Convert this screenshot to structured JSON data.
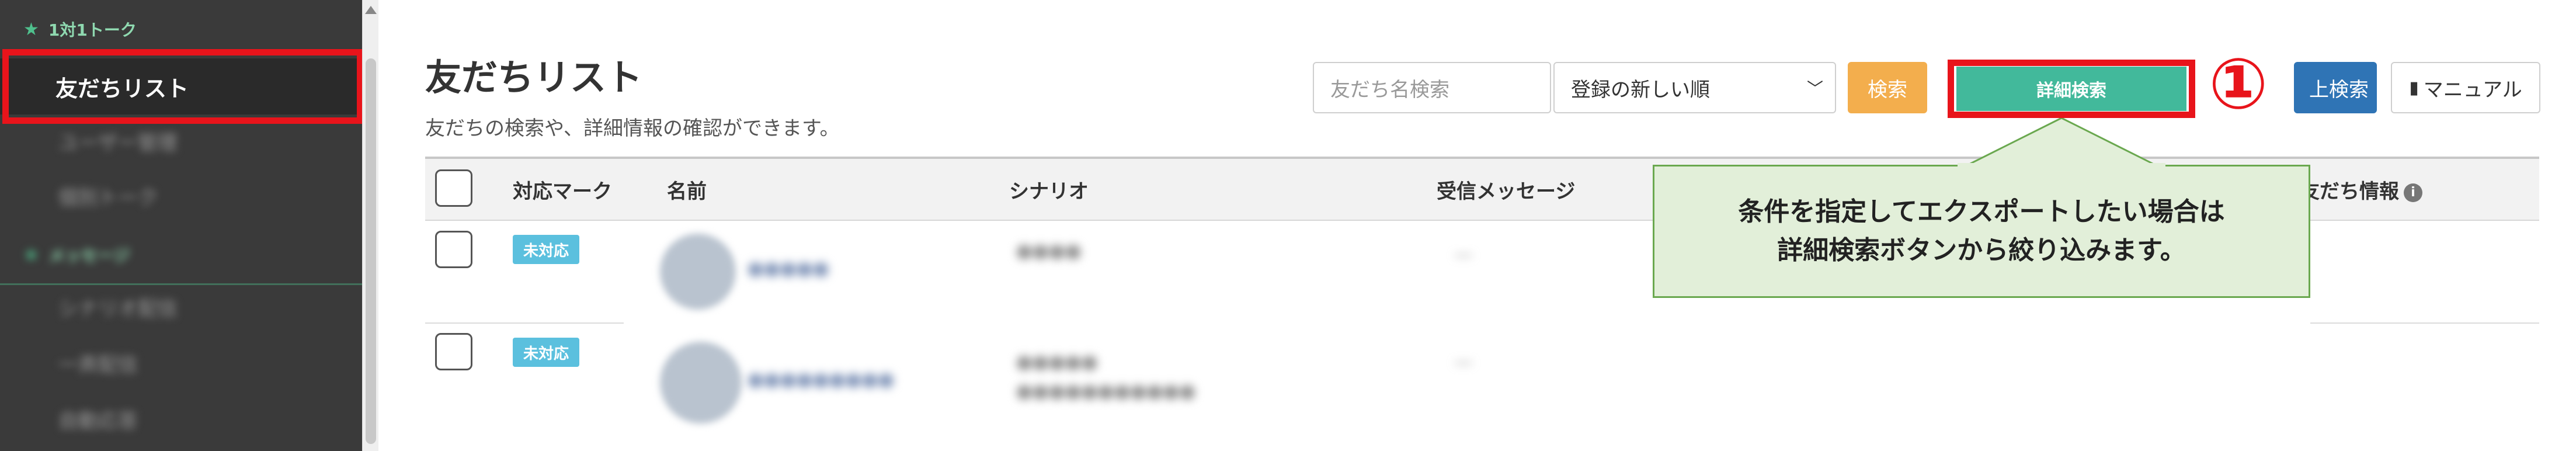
{
  "sidebar": {
    "section_talk": "1対1トーク",
    "active_item": "友だちリスト",
    "item_2": "ユーザー管理",
    "item_3": "個別トーク",
    "section_message": "メッセージ",
    "item_5": "シナリオ配信",
    "item_6": "一斉配信",
    "item_7": "自動応答"
  },
  "header": {
    "title": "友だちリスト",
    "description": "友だちの検索や、詳細情報の確認ができます。",
    "search_placeholder": "友だち名検索",
    "sort_value": "登録の新しい順",
    "search_button": "検索",
    "detail_search_button": "詳細検索",
    "csv_button_partial": "上検索",
    "manual_button": "マニュアル"
  },
  "annotation": {
    "step_number": "①",
    "callout_line1": "条件を指定してエクスポートしたい場合は",
    "callout_line2": "詳細検索ボタンから絞り込みます。"
  },
  "table": {
    "columns": {
      "mark": "対応マーク",
      "name": "名前",
      "scenario": "シナリオ",
      "received": "受信メッセージ",
      "friend_info": "友だち情報"
    },
    "rows": [
      {
        "status": "未対応",
        "name": "●●●●●",
        "scenario": "●●●●",
        "message": "—"
      },
      {
        "status": "未対応",
        "name": "●●●●●●●●●",
        "scenario": "●●●●●",
        "message": "—"
      }
    ]
  },
  "colors": {
    "sidebar_bg": "#3a3a3a",
    "accent_green": "#42b99b",
    "highlight_red": "#e8141b",
    "search_orange": "#f3ae4d",
    "badge_blue": "#5bc0de",
    "callout_bg": "#e2efd9"
  }
}
